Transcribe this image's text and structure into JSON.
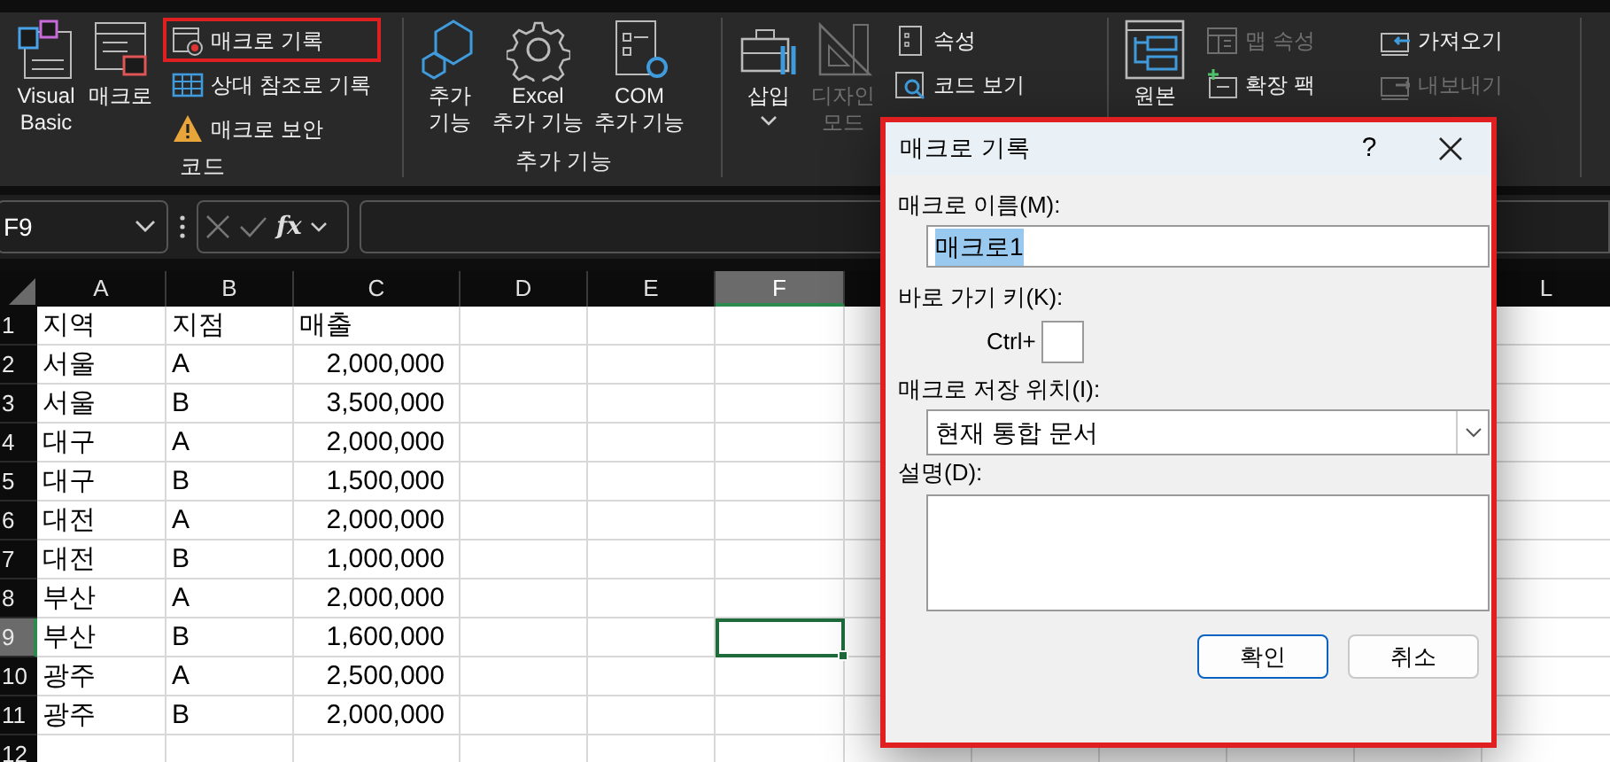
{
  "ribbon": {
    "groups": [
      {
        "label": "코드",
        "large": [
          {
            "label": "Visual\nBasic",
            "disabled": false,
            "dropdown": false
          },
          {
            "label": "매크로",
            "disabled": false,
            "dropdown": false
          }
        ],
        "small_columns": [
          [
            {
              "label": "매크로 기록",
              "disabled": false,
              "highlighted": true
            },
            {
              "label": "상대 참조로 기록",
              "disabled": false,
              "highlighted": false
            },
            {
              "label": "매크로 보안",
              "disabled": false,
              "highlighted": false
            }
          ]
        ]
      },
      {
        "label": "추가 기능",
        "large": [
          {
            "label": "추가\n기능",
            "disabled": false,
            "dropdown": false
          },
          {
            "label": "Excel\n추가 기능",
            "disabled": false,
            "dropdown": false
          },
          {
            "label": "COM\n추가 기능",
            "disabled": false,
            "dropdown": false
          }
        ]
      },
      {
        "large": [
          {
            "label": "삽입",
            "disabled": false,
            "dropdown": true
          },
          {
            "label": "디자인\n모드",
            "disabled": true,
            "dropdown": false
          }
        ],
        "small_columns": [
          [
            {
              "label": "속성",
              "disabled": false,
              "highlighted": false
            },
            {
              "label": "코드 보기",
              "disabled": false,
              "highlighted": false
            }
          ]
        ]
      },
      {
        "large": [
          {
            "label": "원본",
            "disabled": false,
            "dropdown": false
          }
        ],
        "small_columns": [
          [
            {
              "label": "맵 속성",
              "disabled": true,
              "highlighted": false
            },
            {
              "label": "확장 팩",
              "disabled": false,
              "highlighted": false
            }
          ],
          [
            {
              "label": "가져오기",
              "disabled": false,
              "highlighted": false
            },
            {
              "label": "내보내기",
              "disabled": true,
              "highlighted": false
            }
          ]
        ]
      }
    ]
  },
  "formula_bar": {
    "name_box": "F9",
    "fx": "fx"
  },
  "sheet": {
    "columns": [
      {
        "label": "A",
        "selected": false
      },
      {
        "label": "B",
        "selected": false
      },
      {
        "label": "C",
        "selected": false
      },
      {
        "label": "D",
        "selected": false
      },
      {
        "label": "E",
        "selected": false
      },
      {
        "label": "F",
        "selected": true
      },
      {
        "label": "L",
        "selected": false
      }
    ],
    "rows": [
      {
        "number": "1",
        "selected": false,
        "cells": [
          {
            "text": "지역",
            "kind": "text"
          },
          {
            "text": "지점",
            "kind": "text"
          },
          {
            "text": "매출",
            "kind": "text"
          }
        ]
      },
      {
        "number": "2",
        "selected": false,
        "cells": [
          {
            "text": "서울",
            "kind": "text"
          },
          {
            "text": "A",
            "kind": "text"
          },
          {
            "text": "2,000,000",
            "kind": "number"
          }
        ]
      },
      {
        "number": "3",
        "selected": false,
        "cells": [
          {
            "text": "서울",
            "kind": "text"
          },
          {
            "text": "B",
            "kind": "text"
          },
          {
            "text": "3,500,000",
            "kind": "number"
          }
        ]
      },
      {
        "number": "4",
        "selected": false,
        "cells": [
          {
            "text": "대구",
            "kind": "text"
          },
          {
            "text": "A",
            "kind": "text"
          },
          {
            "text": "2,000,000",
            "kind": "number"
          }
        ]
      },
      {
        "number": "5",
        "selected": false,
        "cells": [
          {
            "text": "대구",
            "kind": "text"
          },
          {
            "text": "B",
            "kind": "text"
          },
          {
            "text": "1,500,000",
            "kind": "number"
          }
        ]
      },
      {
        "number": "6",
        "selected": false,
        "cells": [
          {
            "text": "대전",
            "kind": "text"
          },
          {
            "text": "A",
            "kind": "text"
          },
          {
            "text": "2,000,000",
            "kind": "number"
          }
        ]
      },
      {
        "number": "7",
        "selected": false,
        "cells": [
          {
            "text": "대전",
            "kind": "text"
          },
          {
            "text": "B",
            "kind": "text"
          },
          {
            "text": "1,000,000",
            "kind": "number"
          }
        ]
      },
      {
        "number": "8",
        "selected": false,
        "cells": [
          {
            "text": "부산",
            "kind": "text"
          },
          {
            "text": "A",
            "kind": "text"
          },
          {
            "text": "2,000,000",
            "kind": "number"
          }
        ]
      },
      {
        "number": "9",
        "selected": true,
        "cells": [
          {
            "text": "부산",
            "kind": "text"
          },
          {
            "text": "B",
            "kind": "text"
          },
          {
            "text": "1,600,000",
            "kind": "number"
          }
        ]
      },
      {
        "number": "10",
        "selected": false,
        "cells": [
          {
            "text": "광주",
            "kind": "text"
          },
          {
            "text": "A",
            "kind": "text"
          },
          {
            "text": "2,500,000",
            "kind": "number"
          }
        ]
      },
      {
        "number": "11",
        "selected": false,
        "cells": [
          {
            "text": "광주",
            "kind": "text"
          },
          {
            "text": "B",
            "kind": "text"
          },
          {
            "text": "2,000,000",
            "kind": "number"
          }
        ]
      },
      {
        "number": "12",
        "selected": false,
        "cells": []
      }
    ]
  },
  "dialog": {
    "title": "매크로 기록",
    "help": "?",
    "highlighted": true,
    "name_label": "매크로 이름(M):",
    "name_value": "매크로1",
    "name_value_selected": true,
    "shortcut_label": "바로 가기 키(K):",
    "shortcut_prefix": "Ctrl+",
    "store_label": "매크로 저장 위치(I):",
    "store_value": "현재 통합 문서",
    "description_label": "설명(D):",
    "buttons": [
      {
        "label": "확인",
        "default": true
      },
      {
        "label": "취소",
        "default": false
      }
    ]
  }
}
